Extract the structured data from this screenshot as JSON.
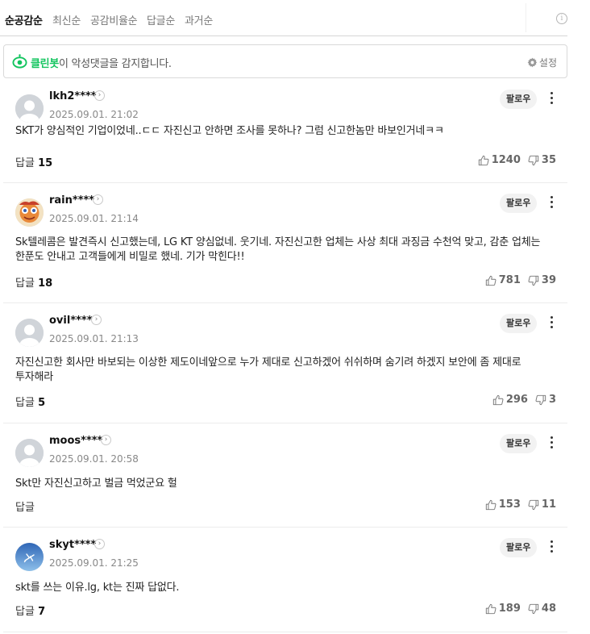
{
  "sort": {
    "tabs": [
      {
        "label": "순공감순",
        "active": true
      },
      {
        "label": "최신순",
        "active": false
      },
      {
        "label": "공감비율순",
        "active": false
      },
      {
        "label": "답글순",
        "active": false
      },
      {
        "label": "과거순",
        "active": false
      }
    ],
    "info_icon": "i"
  },
  "cleanbot": {
    "brand": "클린봇",
    "message": "이 악성댓글을 감지합니다.",
    "settings_label": "설정",
    "icon": "cleanbot-eye-icon",
    "accent": "#12c45e"
  },
  "comments": [
    {
      "username": "lkh2****",
      "date": "2025.09.01. 21:02",
      "follow_label": "팔로우",
      "text": "SKT가 양심적인 기업이었네..ㄷㄷ 자진신고 안하면 조사를 못하나? 그럼 신고한놈만 바보인거네ㅋㅋ",
      "reply_label": "답글",
      "reply_count": "15",
      "likes": "1240",
      "dislikes": "35",
      "avatar": "default-avatar"
    },
    {
      "username": "rain****",
      "date": "2025.09.01. 21:14",
      "follow_label": "팔로우",
      "text": "Sk텔레콤은 발견즉시 신고했는데, LG KT 양심없네. 웃기네. 자진신고한 업체는 사상 최대 과징금 수천억 맞고, 감춘 업체는 한푼도 안내고 고객들에게 비밀로 했네. 기가 막힌다!!",
      "reply_label": "답글",
      "reply_count": "18",
      "likes": "781",
      "dislikes": "39",
      "avatar": "character-avatar"
    },
    {
      "username": "ovil****",
      "date": "2025.09.01. 21:13",
      "follow_label": "팔로우",
      "text": "자진신고한 회사만 바보되는 이상한 제도이네앞으로 누가 제대로 신고하겠어 쉬쉬하며 숨기려 하겠지 보안에 좀 제대로 투자해라",
      "reply_label": "답글",
      "reply_count": "5",
      "likes": "296",
      "dislikes": "3",
      "avatar": "default-avatar"
    },
    {
      "username": "moos****",
      "date": "2025.09.01. 20:58",
      "follow_label": "팔로우",
      "text": "Skt만 자진신고하고 벌금 먹었군요 헐",
      "reply_label": "답글",
      "reply_count": "",
      "likes": "153",
      "dislikes": "11",
      "avatar": "default-avatar"
    },
    {
      "username": "skyt****",
      "date": "2025.09.01. 21:25",
      "follow_label": "팔로우",
      "text": "skt를 쓰는 이유.lg, kt는 진짜 답없다.",
      "reply_label": "답글",
      "reply_count": "7",
      "likes": "189",
      "dislikes": "48",
      "avatar": "sky-airplane-avatar"
    }
  ]
}
